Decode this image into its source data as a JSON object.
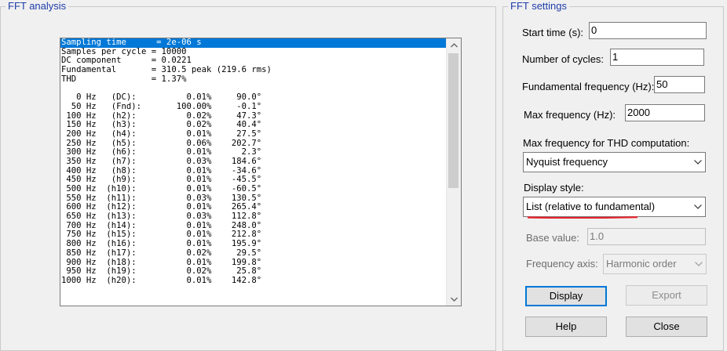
{
  "fft_group": {
    "title": "FFT analysis",
    "list_lines": [
      "Sampling time      = 2e-06 s",
      "Samples per cycle = 10000",
      "DC component      = 0.0221",
      "Fundamental       = 310.5 peak (219.6 rms)",
      "THD               = 1.37%",
      "",
      "   0 Hz   (DC):          0.01%     90.0°",
      "  50 Hz   (Fnd):       100.00%     -0.1°",
      " 100 Hz   (h2):          0.02%     47.3°",
      " 150 Hz   (h3):          0.02%     40.4°",
      " 200 Hz   (h4):          0.01%     27.5°",
      " 250 Hz   (h5):          0.06%    202.7°",
      " 300 Hz   (h6):          0.01%      2.3°",
      " 350 Hz   (h7):          0.03%    184.6°",
      " 400 Hz   (h8):          0.01%    -34.6°",
      " 450 Hz   (h9):          0.01%    -45.5°",
      " 500 Hz  (h10):          0.01%    -60.5°",
      " 550 Hz  (h11):          0.03%    130.5°",
      " 600 Hz  (h12):          0.01%    265.4°",
      " 650 Hz  (h13):          0.03%    112.8°",
      " 700 Hz  (h14):          0.01%    248.0°",
      " 750 Hz  (h15):          0.01%    212.8°",
      " 800 Hz  (h16):          0.01%    195.9°",
      " 850 Hz  (h17):          0.02%     29.5°",
      " 900 Hz  (h18):          0.01%    199.8°",
      " 950 Hz  (h19):          0.02%     25.8°",
      "1000 Hz  (h20):          0.01%    142.8°"
    ],
    "selected_line_index": 0
  },
  "settings": {
    "title": "FFT settings",
    "start_time": {
      "label": "Start time (s):",
      "value": "0"
    },
    "num_cycles": {
      "label": "Number of cycles:",
      "value": "1"
    },
    "fund_freq": {
      "label": "Fundamental frequency (Hz):",
      "value": "50"
    },
    "max_freq": {
      "label": "Max frequency (Hz):",
      "value": "2000"
    },
    "thd_max": {
      "label": "Max frequency for THD computation:",
      "selected": "Nyquist frequency"
    },
    "display_style": {
      "label": "Display style:",
      "selected": "List (relative to fundamental)"
    },
    "base_value": {
      "label": "Base value:",
      "value": "1.0"
    },
    "freq_axis": {
      "label": "Frequency axis:",
      "selected": "Harmonic order"
    },
    "buttons": {
      "display": "Display",
      "export": "Export",
      "help": "Help",
      "close": "Close"
    }
  },
  "colors": {
    "group_title": "#1e3da8",
    "selection": "#0078d7",
    "annotation_underline": "#e8202a"
  }
}
